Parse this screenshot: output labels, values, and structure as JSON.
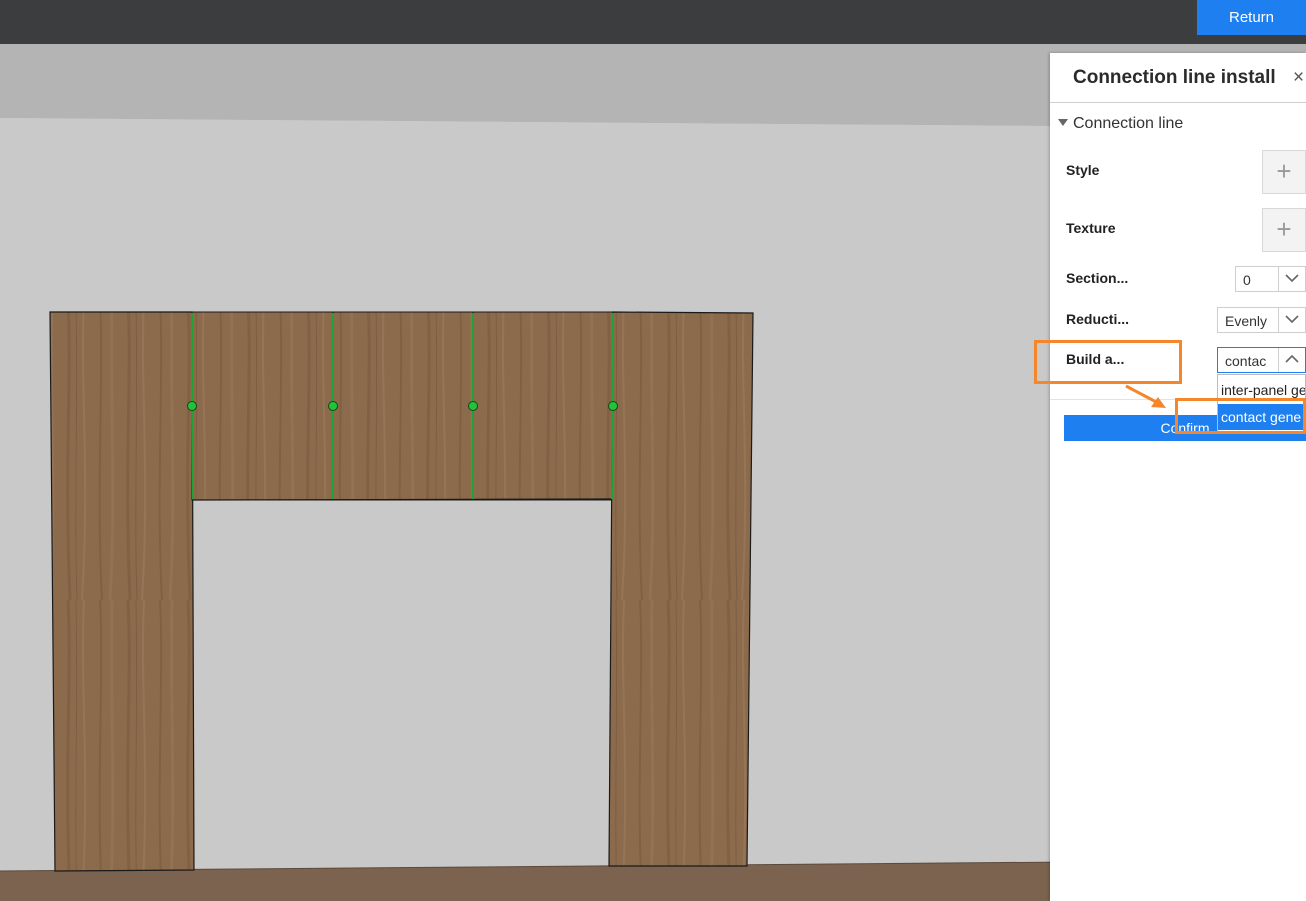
{
  "topbar": {
    "return_label": "Return"
  },
  "panel": {
    "title": "Connection line install",
    "close_glyph": "×",
    "section_label": "Connection line",
    "rows": {
      "style_label": "Style",
      "texture_label": "Texture",
      "section_label": "Section...",
      "section_value": "0",
      "reduction_label": "Reducti...",
      "reduction_value": "Evenly",
      "build_label": "Build a...",
      "build_value": "contac"
    },
    "plus_glyph": "+",
    "dropdown_options": [
      "inter-panel ge",
      "contact gene"
    ],
    "selected_option_index": 1,
    "confirm_label": "Confirm"
  },
  "annotation": {
    "color": "#f5862b"
  },
  "accent": "#1e7ff0",
  "scene": {
    "marker_color": "#22c23a",
    "seam_color": "#1fa336",
    "wood_color": "#8c6a4c"
  }
}
